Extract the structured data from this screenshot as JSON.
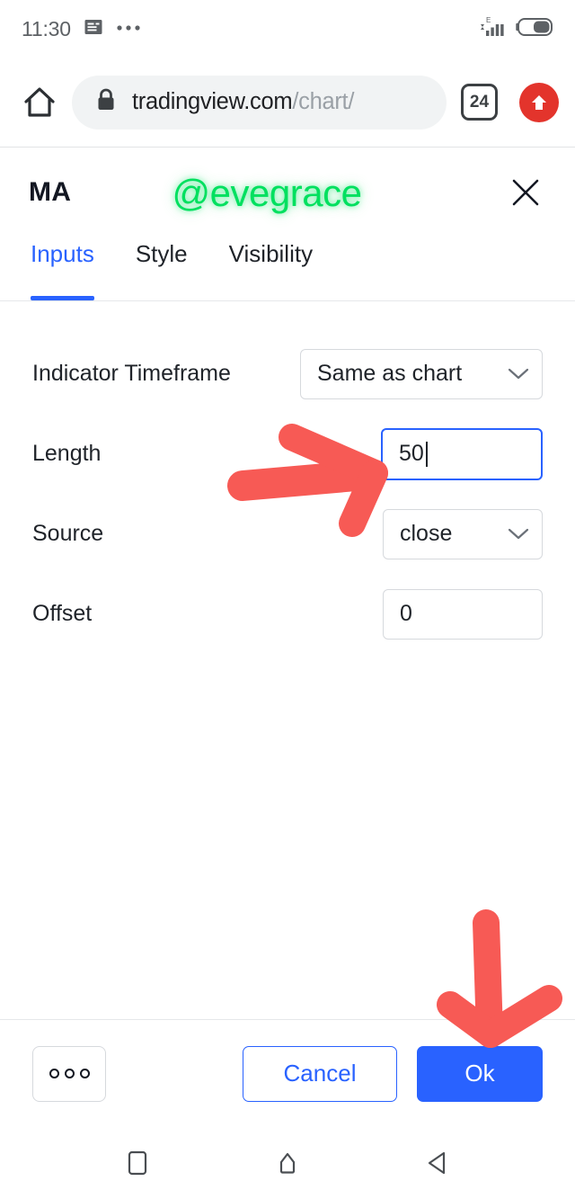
{
  "status_bar": {
    "time": "11:30",
    "icons": [
      "news-icon",
      "more-dots-icon"
    ],
    "right_icons": [
      "signal-bars-icon",
      "battery-icon"
    ],
    "network_label": "E"
  },
  "browser_bar": {
    "home_icon": "home-icon",
    "lock_icon": "lock-icon",
    "url_domain": "tradingview.com",
    "url_path": "/chart/",
    "tab_count": "24",
    "upload_icon": "upload-arrow-icon"
  },
  "dialog": {
    "title": "MA",
    "watermark": "@evegrace",
    "close_icon": "close-icon",
    "tabs": [
      {
        "label": "Inputs",
        "active": true
      },
      {
        "label": "Style",
        "active": false
      },
      {
        "label": "Visibility",
        "active": false
      }
    ],
    "fields": [
      {
        "label": "Indicator Timeframe",
        "type": "select",
        "value": "Same as chart",
        "chevron": "chevron-down-icon"
      },
      {
        "label": "Length",
        "type": "text",
        "value": "50",
        "focused": true
      },
      {
        "label": "Source",
        "type": "select",
        "value": "close",
        "chevron": "chevron-down-icon"
      },
      {
        "label": "Offset",
        "type": "text",
        "value": "0",
        "focused": false
      }
    ],
    "footer": {
      "more_label": "ooo",
      "cancel_label": "Cancel",
      "ok_label": "Ok"
    }
  },
  "android_nav": {
    "recents_icon": "recents-square-icon",
    "home_icon": "home-pentagon-icon",
    "back_icon": "back-triangle-icon"
  },
  "annotations": {
    "arrow_color": "#f75a55",
    "arrows": [
      {
        "name": "arrow-to-length-field",
        "direction": "right"
      },
      {
        "name": "arrow-to-ok-button",
        "direction": "down"
      }
    ]
  },
  "colors": {
    "accent_blue": "#2962ff",
    "watermark_green": "#00e05f",
    "annotation_red": "#f75a55",
    "upload_red": "#e3342c"
  }
}
